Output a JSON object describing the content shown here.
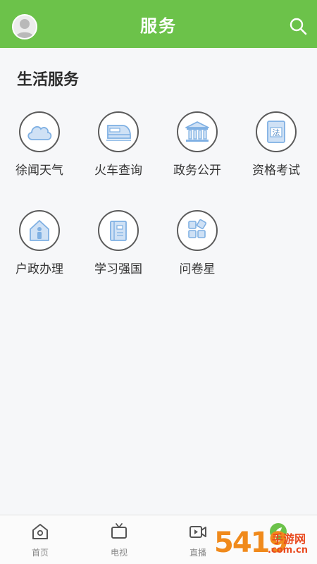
{
  "header": {
    "title": "服务"
  },
  "section": {
    "title": "生活服务",
    "items": [
      {
        "label": "徐闻天气",
        "icon": "cloud-icon"
      },
      {
        "label": "火车查询",
        "icon": "train-icon"
      },
      {
        "label": "政务公开",
        "icon": "government-building-icon"
      },
      {
        "label": "资格考试",
        "icon": "law-book-icon"
      },
      {
        "label": "户政办理",
        "icon": "house-person-icon"
      },
      {
        "label": "学习强国",
        "icon": "study-book-icon"
      },
      {
        "label": "问卷星",
        "icon": "app-grid-icon"
      }
    ]
  },
  "bottom_nav": {
    "items": [
      {
        "label": "首页",
        "icon": "home-icon"
      },
      {
        "label": "电视",
        "icon": "tv-icon"
      },
      {
        "label": "直播",
        "icon": "live-video-icon"
      },
      {
        "label": "",
        "icon": "leaf-icon"
      }
    ]
  },
  "watermark": {
    "number": "5419",
    "cn": "手游网",
    "domain": ".com.cn"
  },
  "colors": {
    "accent": "#6cc24a",
    "icon_blue": "#7fb0e3",
    "icon_border": "#5b5b5b"
  }
}
